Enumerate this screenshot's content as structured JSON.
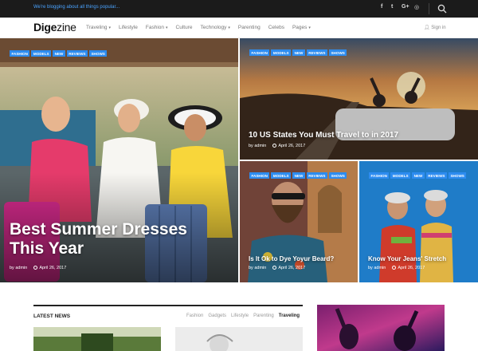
{
  "topbar": {
    "tagline": "We're blogging about all things popular...",
    "social": [
      "f",
      "t",
      "G+",
      "◎"
    ],
    "search_icon": "search-icon"
  },
  "nav": {
    "logo_bold": "Dige",
    "logo_light": "zine",
    "items": [
      {
        "label": "Traveling",
        "dropdown": true
      },
      {
        "label": "Lifestyle",
        "dropdown": false
      },
      {
        "label": "Fashion",
        "dropdown": true
      },
      {
        "label": "Culture",
        "dropdown": false
      },
      {
        "label": "Technology",
        "dropdown": true
      },
      {
        "label": "Parenting",
        "dropdown": false
      },
      {
        "label": "Celebs",
        "dropdown": false
      },
      {
        "label": "Pages",
        "dropdown": true
      }
    ],
    "signin": "Sign in"
  },
  "tags": [
    "Fashion",
    "Models",
    "New",
    "Reviews",
    "Shows"
  ],
  "posts": {
    "main": {
      "title": "Best Summer Dresses This Year",
      "author": "by admin",
      "date": "April 26, 2017"
    },
    "road": {
      "title": "10 US States You Must Travel to in 2017",
      "author": "by admin",
      "date": "April 26, 2017"
    },
    "beard": {
      "title": "Is It Ok to Dye Yoyur Beard?",
      "author": "by admin",
      "date": "April 26, 2017"
    },
    "jeans": {
      "title": "Know Your Jeans' Stretch",
      "author": "by admin",
      "date": "April 26, 2017"
    }
  },
  "latest": {
    "title": "LATEST NEWS",
    "tabs": [
      "Fashion",
      "Gadgets",
      "Lifestyle",
      "Parenting",
      "Traveling"
    ],
    "active_tab": "Traveling"
  },
  "colors": {
    "accent": "#2d8cf0",
    "topbar": "#1b1b1b",
    "tagline": "#4aa3ff"
  }
}
